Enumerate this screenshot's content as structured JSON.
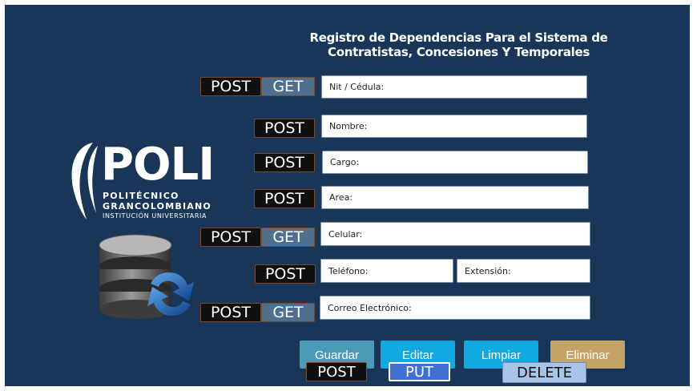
{
  "form": {
    "title_line1": "Registro de Dependencias Para el Sistema de",
    "title_line2": "Contratistas, Concesiones  Y Temporales",
    "fields": {
      "nit": "Nit  / Cédula:",
      "nombre": "Nombre:",
      "cargo": "Cargo:",
      "area": "Area:",
      "celular": "Celular:",
      "telefono": "Teléfono:",
      "extension": "Extensión:",
      "correo": "Correo Electrónico:"
    }
  },
  "tags": {
    "post": "POST",
    "get": "GET",
    "put": "PUT",
    "delete": "DELETE"
  },
  "buttons": {
    "guardar": "Guardar",
    "editar": "Editar",
    "limpiar": "Limpiar",
    "eliminar": "Eliminar"
  },
  "logo": {
    "name": "POLI",
    "line1": "POLITÉCNICO",
    "line2": "GRANCOLOMBIANO",
    "line3": "INSTITUCIÓN UNIVERSITARIA"
  },
  "colors": {
    "panel": "#193558",
    "guardar": "#4a9ab8",
    "editar_limpiar": "#11a9e0",
    "eliminar": "#c5a266",
    "get_tag": "#4f6f8f"
  }
}
